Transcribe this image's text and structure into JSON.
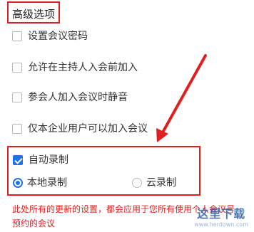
{
  "section_title": "高级选项",
  "options": [
    {
      "label": "设置会议密码",
      "checked": false
    },
    {
      "label": "允许在主持人入会前加入",
      "checked": false
    },
    {
      "label": "参会人加入会议时静音",
      "checked": false
    },
    {
      "label": "仅本企业用户可以加入会议",
      "checked": false
    }
  ],
  "auto_record": {
    "label": "自动录制",
    "checked": true
  },
  "record_modes": [
    {
      "label": "本地录制",
      "selected": true
    },
    {
      "label": "云录制",
      "selected": false
    }
  ],
  "notice": "此处所有的更新的设置，都会应用于您所有使用个人会议号预约的会议",
  "watermark": {
    "brand": "这里下载",
    "url": "www.herdown.com"
  },
  "colors": {
    "accent": "#1f73e8",
    "highlight": "#e02020"
  }
}
